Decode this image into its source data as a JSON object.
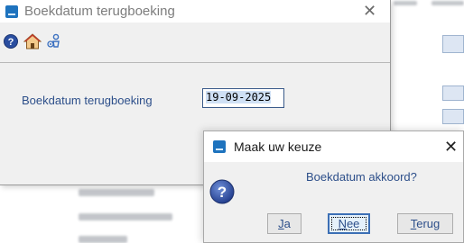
{
  "main_window": {
    "title": "Boekdatum terugboeking",
    "toolbar": {
      "icons": [
        "help-icon",
        "home-icon",
        "settings-person-icon"
      ]
    },
    "form": {
      "date_label": "Boekdatum terugboeking",
      "date_value": "19-09-2025"
    }
  },
  "dialog": {
    "title": "Maak uw keuze",
    "message": "Boekdatum akkoord?",
    "buttons": {
      "yes": {
        "mnemonic": "J",
        "rest": "a"
      },
      "no": {
        "mnemonic": "N",
        "rest": "ee"
      },
      "back": {
        "mnemonic": "T",
        "rest": "erug"
      }
    },
    "default_button": "no"
  },
  "colors": {
    "accent": "#2d4f8a",
    "app_icon": "#1e73be",
    "help_icon": "#2a4ea0",
    "window_bg": "#f0f0f0"
  }
}
